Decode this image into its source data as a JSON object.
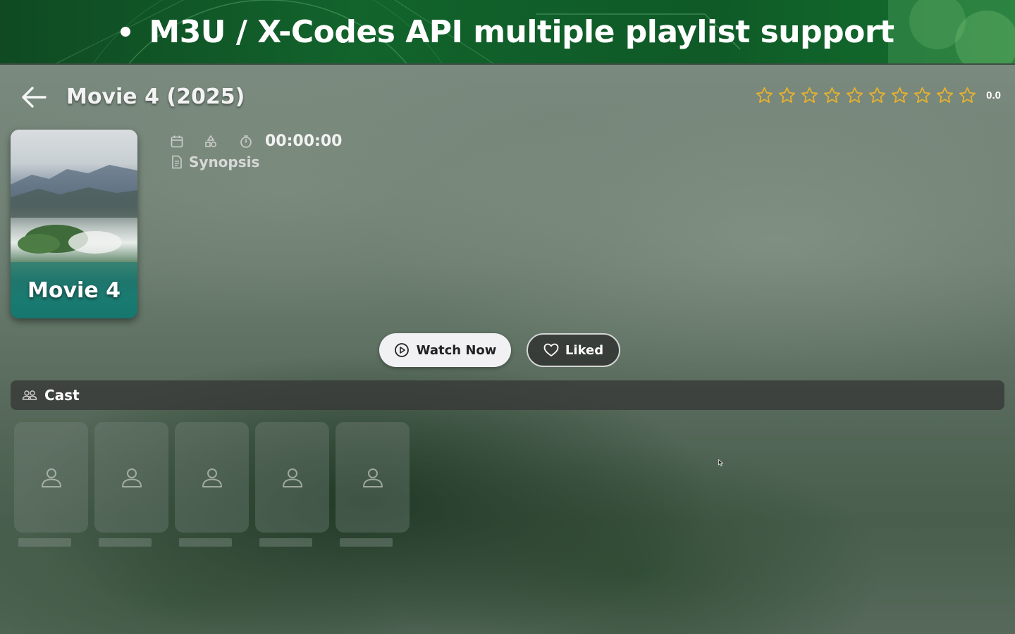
{
  "banner": {
    "text": "M3U / X-Codes API multiple playlist support"
  },
  "header": {
    "title": "Movie 4 (2025)"
  },
  "rating": {
    "stars_total": 10,
    "stars_filled": 0,
    "value": "0.0",
    "star_color": "#e8b22c"
  },
  "poster": {
    "label": "Movie 4"
  },
  "meta": {
    "icons": [
      "calendar-icon",
      "category-icon",
      "timer-icon"
    ],
    "duration": "00:00:00",
    "synopsis_label": "Synopsis"
  },
  "actions": {
    "watch_label": "Watch Now",
    "liked_label": "Liked"
  },
  "cast": {
    "title": "Cast",
    "members": [
      {
        "name": ""
      },
      {
        "name": ""
      },
      {
        "name": ""
      },
      {
        "name": ""
      },
      {
        "name": ""
      }
    ]
  }
}
